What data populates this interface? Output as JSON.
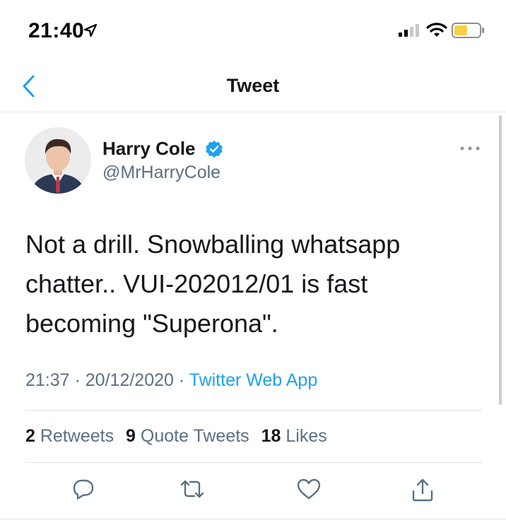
{
  "status_bar": {
    "time": "21:40"
  },
  "nav": {
    "title": "Tweet"
  },
  "tweet": {
    "display_name": "Harry Cole",
    "handle": "@MrHarryCole",
    "text": "Not a drill. Snowballing whatsapp\nchatter..  VUI-202012/01 is fast\nbecoming \"Superona\".",
    "time": "21:37",
    "separator": " · ",
    "date": "20/12/2020",
    "source": "Twitter Web App"
  },
  "stats": {
    "retweets_count": "2",
    "retweets_label": "Retweets",
    "quotes_count": "9",
    "quotes_label": "Quote Tweets",
    "likes_count": "18",
    "likes_label": "Likes"
  },
  "colors": {
    "accent": "#1da1f2",
    "secondary_text": "#5b7083",
    "battery_fill": "#f7d046"
  },
  "icons": [
    "back-chevron-icon",
    "verified-icon",
    "more-icon",
    "reply-icon",
    "retweet-icon",
    "like-icon",
    "share-icon"
  ]
}
